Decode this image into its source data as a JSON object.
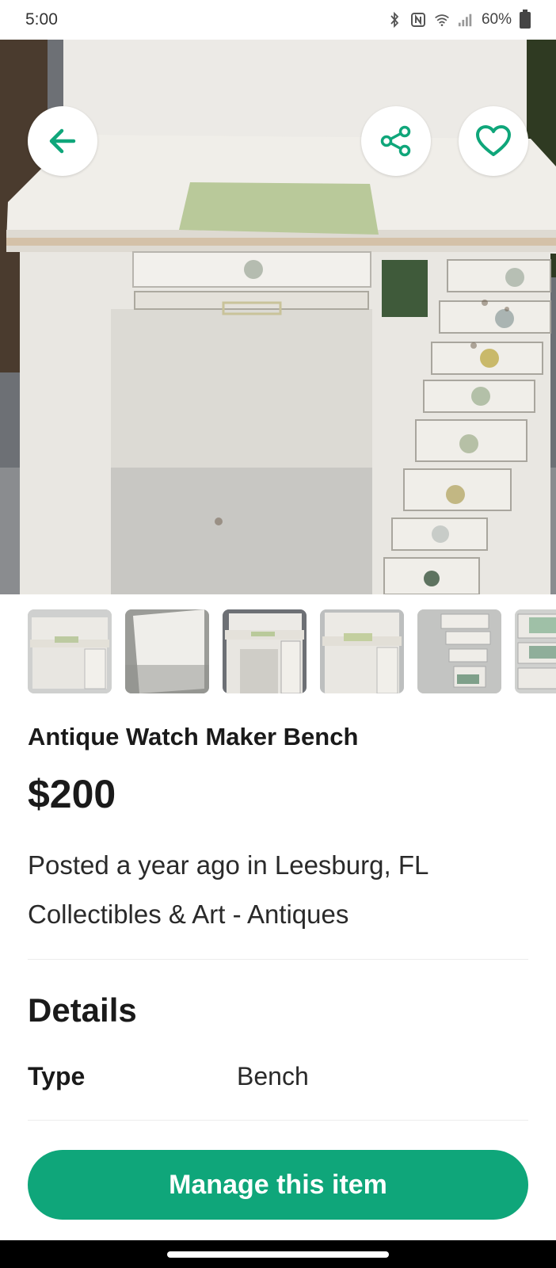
{
  "status_bar": {
    "time": "5:00",
    "battery": "60%",
    "icons": [
      "bluetooth-icon",
      "nfc-icon",
      "wifi-icon",
      "signal-icon",
      "battery-icon"
    ]
  },
  "header_actions": {
    "back_icon": "arrow-left-icon",
    "share_icon": "share-icon",
    "favorite_icon": "heart-icon"
  },
  "listing": {
    "title": "Antique Watch Maker Bench",
    "price": "$200",
    "posted": "Posted a year ago in Leesburg, FL",
    "category": "Collectibles & Art - Antiques"
  },
  "details": {
    "heading": "Details",
    "rows": [
      {
        "key": "Type",
        "value": "Bench"
      }
    ]
  },
  "actions": {
    "manage_label": "Manage this item"
  },
  "colors": {
    "accent": "#0fa67a",
    "text": "#1a1a1a"
  }
}
